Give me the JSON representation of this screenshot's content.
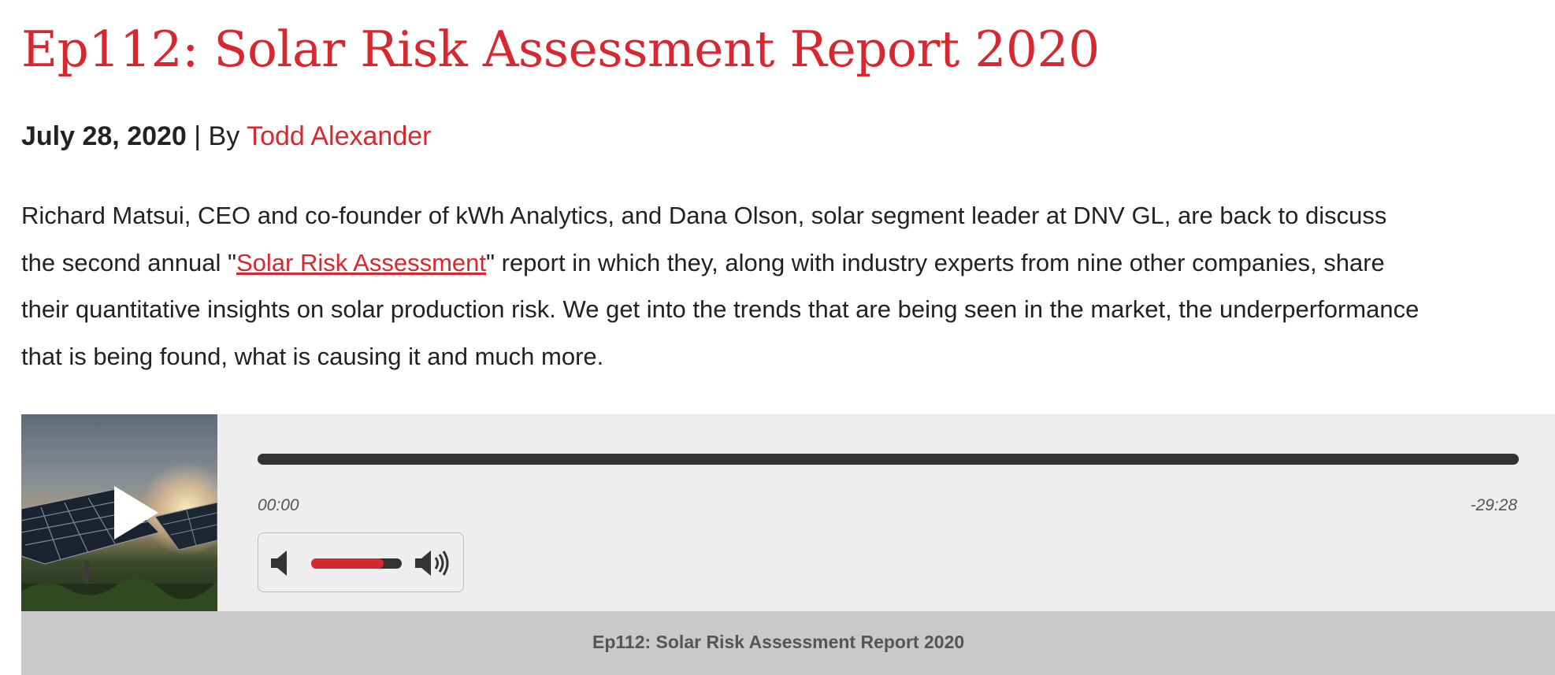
{
  "post": {
    "title": "Ep112: Solar Risk Assessment Report 2020",
    "date": "July 28, 2020",
    "separator": " | By ",
    "author": "Todd Alexander",
    "excerpt": {
      "line1": "Richard Matsui, CEO and co-founder of kWh Analytics, and Dana Olson, solar segment leader at DNV GL, are back to discuss",
      "line2_before": "the second annual \"",
      "line2_link": "Solar Risk Assessment",
      "line2_after": "\" report in which they, along with industry experts from nine other companies, share",
      "line3": "their quantitative insights on solar production risk. We get into the trends that are being seen in the market, the underperformance",
      "line4": "that is being found, what is causing it and much more."
    }
  },
  "player": {
    "current_time": "00:00",
    "remaining_time": "-29:28",
    "progress_fraction": 0,
    "volume_fraction": 0.8,
    "caption": "Ep112: Solar Risk Assessment Report 2020",
    "icons": {
      "play": "play-icon",
      "mute": "speaker-mute-icon",
      "volume_max": "speaker-loud-icon"
    },
    "colors": {
      "accent": "#d7282f",
      "track": "#333333",
      "background": "#eeeeee",
      "caption_bar": "#c9c9c9"
    }
  }
}
